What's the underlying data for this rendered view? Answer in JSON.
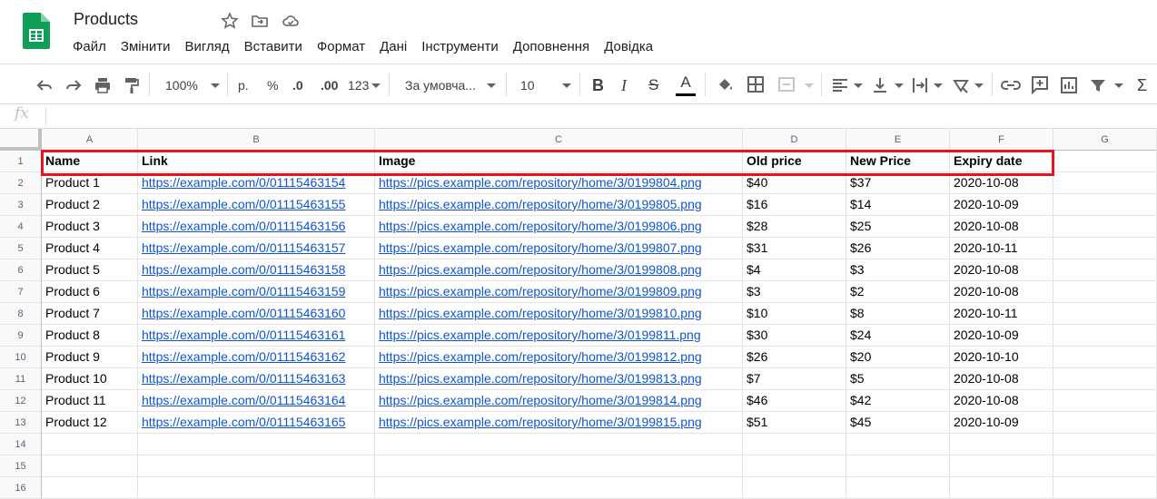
{
  "app": {
    "title": "Products",
    "brand_color": "#0f9d58",
    "menu": [
      "Файл",
      "Змінити",
      "Вигляд",
      "Вставити",
      "Формат",
      "Дані",
      "Інструменти",
      "Доповнення",
      "Довідка"
    ]
  },
  "toolbar": {
    "zoom": "100%",
    "currency": "р.",
    "percent": "%",
    "decimal_decrease": ".0",
    "decimal_increase": ".00",
    "more_formats": "123",
    "font": "За умовча...",
    "font_size": "10",
    "icons": [
      "undo-icon",
      "redo-icon",
      "print-icon",
      "paint-format-icon",
      "bold-icon",
      "italic-icon",
      "strikethrough-icon",
      "text-color-icon",
      "fill-color-icon",
      "borders-icon",
      "merge-cells-icon",
      "align-horizontal-icon",
      "align-vertical-icon",
      "text-wrap-icon",
      "text-rotate-icon",
      "link-icon",
      "comment-icon",
      "chart-icon",
      "filter-icon",
      "functions-icon"
    ]
  },
  "formula_bar": {
    "label": "fx",
    "value": ""
  },
  "columns": [
    "A",
    "B",
    "C",
    "D",
    "E",
    "F",
    "G"
  ],
  "rows": [
    [
      "Name",
      "Link",
      "Image",
      "Old price",
      "New Price",
      "Expiry date"
    ],
    [
      "Product 1",
      "https://example.com/0/01115463154",
      "https://pics.example.com/repository/home/3/0199804.png",
      "$40",
      "$37",
      "2020-10-08"
    ],
    [
      "Product 2",
      "https://example.com/0/01115463155",
      "https://pics.example.com/repository/home/3/0199805.png",
      "$16",
      "$14",
      "2020-10-09"
    ],
    [
      "Product 3",
      "https://example.com/0/01115463156",
      "https://pics.example.com/repository/home/3/0199806.png",
      "$28",
      "$25",
      "2020-10-08"
    ],
    [
      "Product 4",
      "https://example.com/0/01115463157",
      "https://pics.example.com/repository/home/3/0199807.png",
      "$31",
      "$26",
      "2020-10-11"
    ],
    [
      "Product 5",
      "https://example.com/0/01115463158",
      "https://pics.example.com/repository/home/3/0199808.png",
      "$4",
      "$3",
      "2020-10-08"
    ],
    [
      "Product 6",
      "https://example.com/0/01115463159",
      "https://pics.example.com/repository/home/3/0199809.png",
      "$3",
      "$2",
      "2020-10-08"
    ],
    [
      "Product 7",
      "https://example.com/0/01115463160",
      "https://pics.example.com/repository/home/3/0199810.png",
      "$10",
      "$8",
      "2020-10-11"
    ],
    [
      "Product 8",
      "https://example.com/0/01115463161",
      "https://pics.example.com/repository/home/3/0199811.png",
      "$30",
      "$24",
      "2020-10-09"
    ],
    [
      "Product 9",
      "https://example.com/0/01115463162",
      "https://pics.example.com/repository/home/3/0199812.png",
      "$26",
      "$20",
      "2020-10-10"
    ],
    [
      "Product 10",
      "https://example.com/0/01115463163",
      "https://pics.example.com/repository/home/3/0199813.png",
      "$7",
      "$5",
      "2020-10-08"
    ],
    [
      "Product 11",
      "https://example.com/0/01115463164",
      "https://pics.example.com/repository/home/3/0199814.png",
      "$46",
      "$42",
      "2020-10-08"
    ],
    [
      "Product 12",
      "https://example.com/0/01115463165",
      "https://pics.example.com/repository/home/3/0199815.png",
      "$51",
      "$45",
      "2020-10-09"
    ],
    [
      "",
      "",
      "",
      "",
      "",
      ""
    ],
    [
      "",
      "",
      "",
      "",
      "",
      ""
    ],
    [
      "",
      "",
      "",
      "",
      "",
      ""
    ]
  ],
  "link_color": "#1155cc",
  "highlight_color": "#e8141b"
}
